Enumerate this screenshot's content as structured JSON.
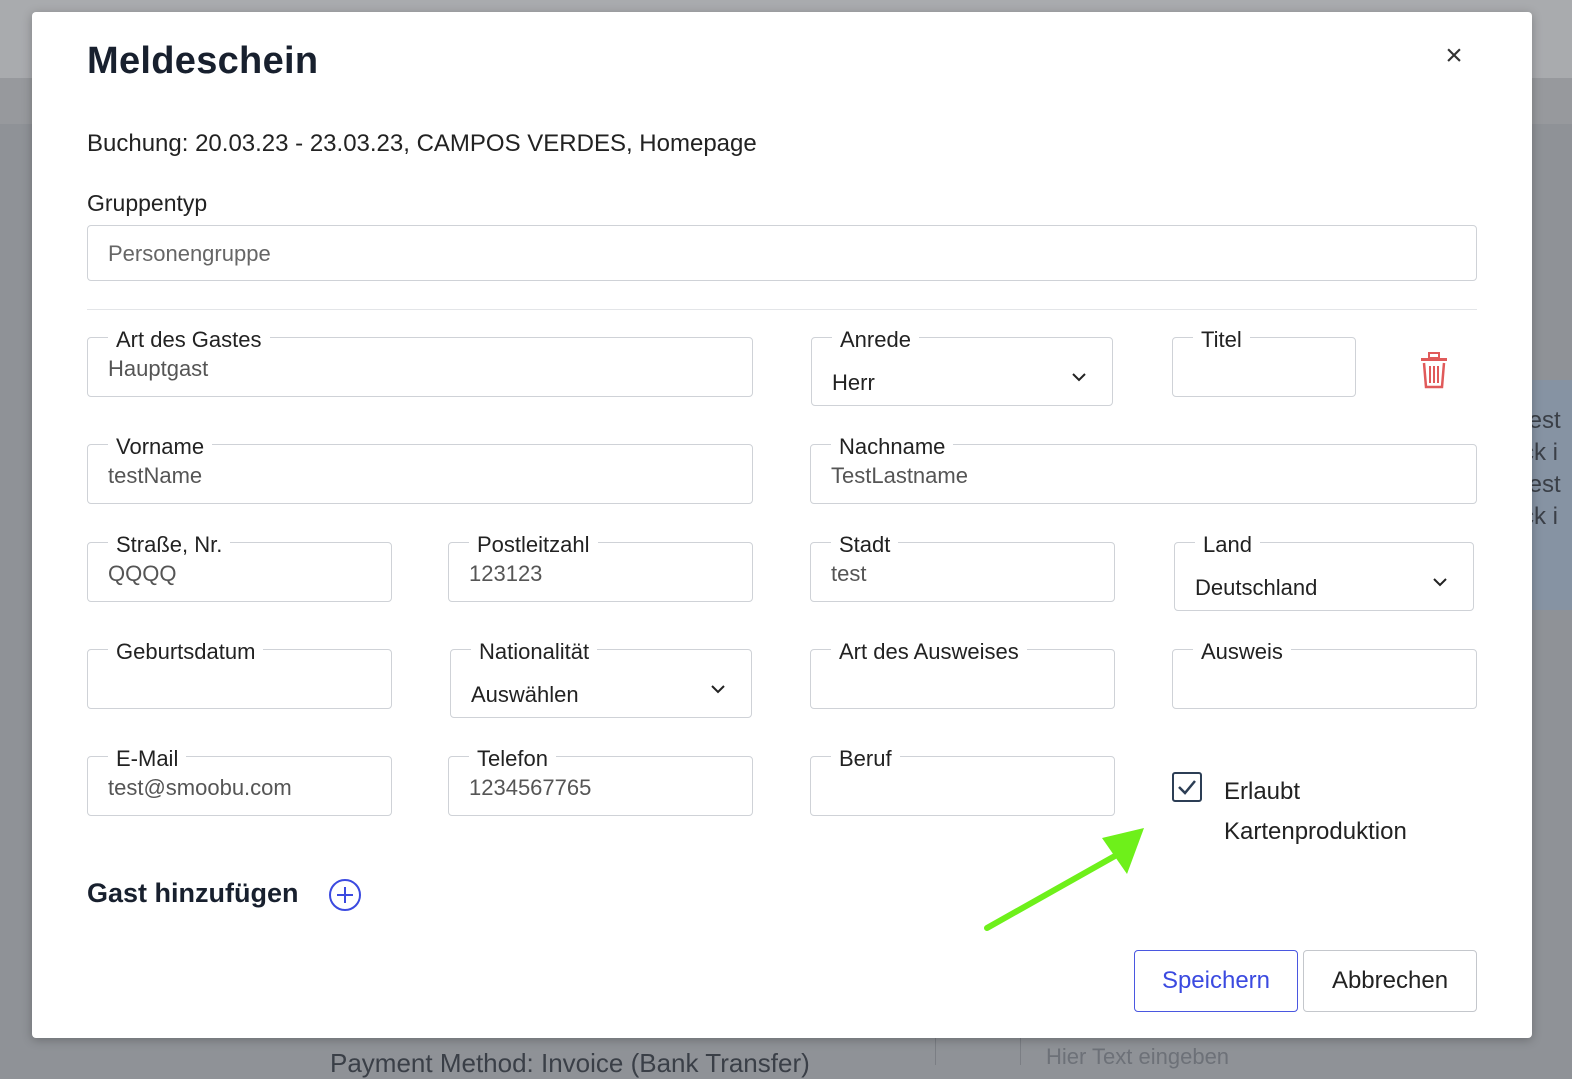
{
  "background": {
    "side_text": [
      "test",
      "ck i",
      "test",
      "ck i"
    ],
    "bottom_left_text": "Payment Method: Invoice (Bank Transfer)",
    "bottom_right_placeholder": "Hier Text eingeben"
  },
  "modal": {
    "title": "Meldeschein",
    "close_label": "×",
    "booking": "Buchung: 20.03.23 - 23.03.23, CAMPOS VERDES, Homepage",
    "group_type_label": "Gruppentyp",
    "group_type_value": "Personengruppe"
  },
  "guest": {
    "art_des_gastes": {
      "label": "Art des Gastes",
      "value": "Hauptgast"
    },
    "anrede": {
      "label": "Anrede",
      "value": "Herr"
    },
    "titel": {
      "label": "Titel",
      "value": ""
    },
    "vorname": {
      "label": "Vorname",
      "value": "testName"
    },
    "nachname": {
      "label": "Nachname",
      "value": "TestLastname"
    },
    "strasse": {
      "label": "Straße, Nr.",
      "value": "QQQQ"
    },
    "postleitzahl": {
      "label": "Postleitzahl",
      "value": "123123"
    },
    "stadt": {
      "label": "Stadt",
      "value": "test"
    },
    "land": {
      "label": "Land",
      "value": "Deutschland"
    },
    "geburtsdatum": {
      "label": "Geburtsdatum",
      "value": ""
    },
    "nationalitaet": {
      "label": "Nationalität",
      "value": "Auswählen"
    },
    "art_des_ausweises": {
      "label": "Art des Ausweises",
      "value": ""
    },
    "ausweis": {
      "label": "Ausweis",
      "value": ""
    },
    "email": {
      "label": "E-Mail",
      "value": "test@smoobu.com"
    },
    "telefon": {
      "label": "Telefon",
      "value": "1234567765"
    },
    "beruf": {
      "label": "Beruf",
      "value": ""
    },
    "kartenproduktion": {
      "label_line1": "Erlaubt",
      "label_line2": "Kartenproduktion",
      "checked": true
    }
  },
  "actions": {
    "add_guest": "Gast hinzufügen",
    "save": "Speichern",
    "cancel": "Abbrechen"
  },
  "colors": {
    "accent": "#3b4ae0",
    "delete": "#e05a5a",
    "annotation_arrow": "#6ef01a"
  }
}
